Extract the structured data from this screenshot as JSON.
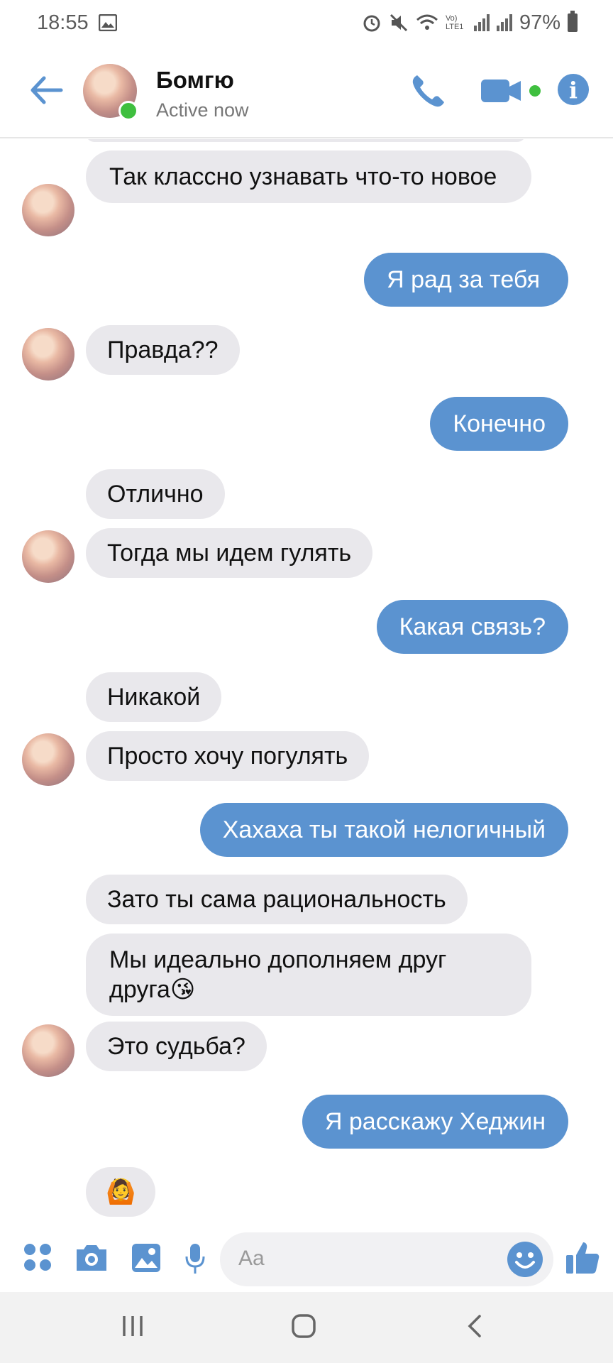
{
  "status_bar": {
    "time": "18:55",
    "battery": "97%",
    "network_label": "Vo) LTE1"
  },
  "header": {
    "contact_name": "Бомгю",
    "contact_status": "Active now"
  },
  "messages": [
    {
      "side": "in",
      "text": "Так классно узнавать что-то новое"
    },
    {
      "side": "out",
      "text": "Я рад за тебя"
    },
    {
      "side": "in",
      "text": "Правда??"
    },
    {
      "side": "out",
      "text": "Конечно"
    },
    {
      "side": "in",
      "text": "Отлично"
    },
    {
      "side": "in",
      "text": "Тогда мы идем гулять"
    },
    {
      "side": "out",
      "text": "Какая связь?"
    },
    {
      "side": "in",
      "text": "Никакой"
    },
    {
      "side": "in",
      "text": "Просто хочу погулять"
    },
    {
      "side": "out",
      "text": "Хахаха ты такой нелогичный"
    },
    {
      "side": "in",
      "text": "Зато ты сама рациональность"
    },
    {
      "side": "in",
      "text": "Мы идеально дополняем друг друга😘"
    },
    {
      "side": "in",
      "text": "Это судьба?"
    },
    {
      "side": "out",
      "text": "Я расскажу Хеджин"
    },
    {
      "side": "in",
      "text": "🙆"
    }
  ],
  "composer": {
    "placeholder": "Aa"
  },
  "colors": {
    "accent": "#5b93d0",
    "incoming_bubble": "#e9e8ec",
    "online": "#3fbf3f"
  },
  "icons": [
    "back-arrow-icon",
    "phone-icon",
    "video-camera-icon",
    "info-icon",
    "apps-icon",
    "camera-icon",
    "gallery-icon",
    "microphone-icon",
    "emoji-icon",
    "thumbs-up-icon",
    "recents-icon",
    "home-icon",
    "back-icon"
  ]
}
